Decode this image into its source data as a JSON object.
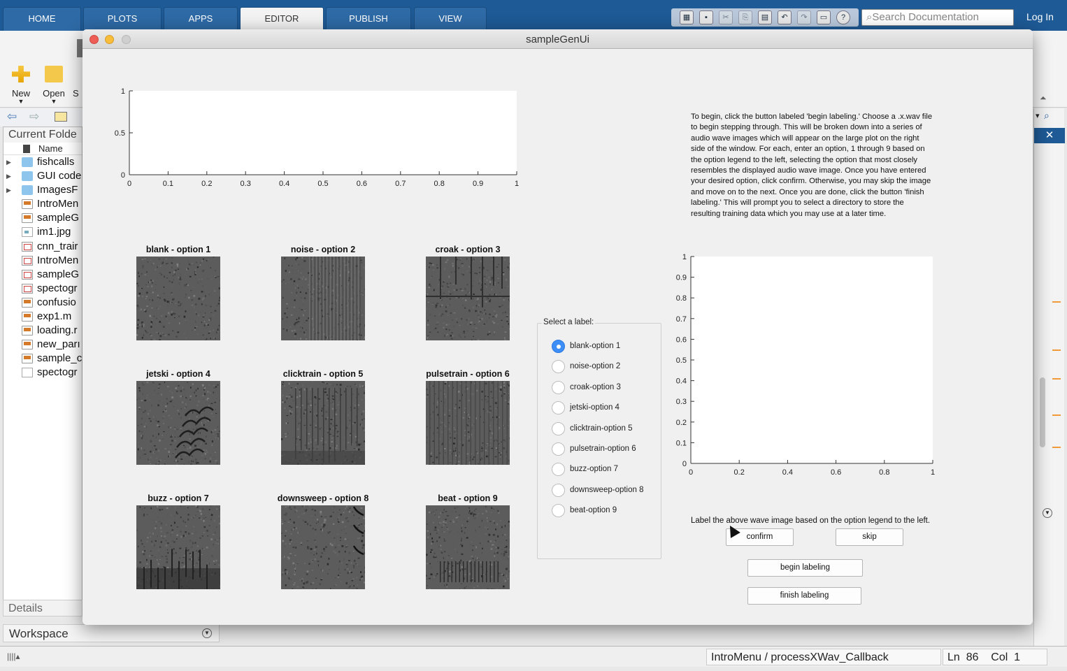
{
  "matlab": {
    "tabs": [
      {
        "label": "HOME",
        "active": false
      },
      {
        "label": "PLOTS",
        "active": false
      },
      {
        "label": "APPS",
        "active": false
      },
      {
        "label": "EDITOR",
        "active": true
      },
      {
        "label": "PUBLISH",
        "active": false
      },
      {
        "label": "VIEW",
        "active": false
      }
    ],
    "search_placeholder": "Search Documentation",
    "login_label": "Log In",
    "toolstrip": {
      "new_label": "New",
      "open_label": "Open",
      "save_partial": "S"
    },
    "current_folder": {
      "title": "Current Folde",
      "name_header": "Name",
      "items": [
        {
          "label": "fishcalls",
          "type": "folder",
          "expandable": true
        },
        {
          "label": "GUI code",
          "type": "folder",
          "expandable": true
        },
        {
          "label": "ImagesF",
          "type": "folder",
          "expandable": true
        },
        {
          "label": "IntroMen",
          "type": "mfile"
        },
        {
          "label": "sampleG",
          "type": "mfile"
        },
        {
          "label": "im1.jpg",
          "type": "img"
        },
        {
          "label": "cnn_trair",
          "type": "fig"
        },
        {
          "label": "IntroMen",
          "type": "fig"
        },
        {
          "label": "sampleG",
          "type": "fig"
        },
        {
          "label": "spectogr",
          "type": "fig"
        },
        {
          "label": "confusio",
          "type": "mfile"
        },
        {
          "label": "exp1.m",
          "type": "mfile"
        },
        {
          "label": "loading.r",
          "type": "mfile"
        },
        {
          "label": "new_parı",
          "type": "mfile"
        },
        {
          "label": "sample_c",
          "type": "mfile"
        },
        {
          "label": "spectogr",
          "type": "blank"
        }
      ]
    },
    "details_label": "Details",
    "workspace_label": "Workspace",
    "status": {
      "file": "IntroMenu / processXWav_Callback",
      "ln_label": "Ln",
      "ln": "86",
      "col_label": "Col",
      "col": "1"
    }
  },
  "window": {
    "title": "sampleGenUi",
    "top_axes": {
      "xlim": [
        0,
        1
      ],
      "ylim": [
        0,
        1
      ],
      "xticks": [
        "0",
        "0.1",
        "0.2",
        "0.3",
        "0.4",
        "0.5",
        "0.6",
        "0.7",
        "0.8",
        "0.9",
        "1"
      ],
      "yticks": [
        "0",
        "0.5",
        "1"
      ]
    },
    "samples": [
      {
        "title": "blank - option 1",
        "pattern": "blank"
      },
      {
        "title": "noise - option 2",
        "pattern": "noise"
      },
      {
        "title": "croak - option 3",
        "pattern": "croak"
      },
      {
        "title": "jetski - option 4",
        "pattern": "jetski"
      },
      {
        "title": "clicktrain - option 5",
        "pattern": "clicktrain"
      },
      {
        "title": "pulsetrain - option 6",
        "pattern": "pulsetrain"
      },
      {
        "title": "buzz - option 7",
        "pattern": "buzz"
      },
      {
        "title": "downsweep - option 8",
        "pattern": "downsweep"
      },
      {
        "title": "beat - option 9",
        "pattern": "beat"
      }
    ],
    "label_group": {
      "title": "Select a label:",
      "options": [
        {
          "label": "blank-option 1",
          "selected": true
        },
        {
          "label": "noise-option 2",
          "selected": false
        },
        {
          "label": "croak-option 3",
          "selected": false
        },
        {
          "label": "jetski-option 4",
          "selected": false
        },
        {
          "label": "clicktrain-option 5",
          "selected": false
        },
        {
          "label": "pulsetrain-option 6",
          "selected": false
        },
        {
          "label": "buzz-option 7",
          "selected": false
        },
        {
          "label": "downsweep-option 8",
          "selected": false
        },
        {
          "label": "beat-option 9",
          "selected": false
        }
      ]
    },
    "instructions": "To begin, click the button labeled 'begin labeling.' Choose a .x.wav file to begin stepping through. This will be broken down into a series of audio wave images which will appear on the large plot on the right side of the window. For each, enter an option, 1 through 9 based on the option legend to the left, selecting the option that most closely resembles the displayed audio wave image. Once you have entered your desired option, click confirm. Otherwise, you may skip the image and move on to the next. Once you are done, click the button 'finish labeling.' This will prompt you to select a directory to store the resulting training data which you may use at a later time.",
    "right_axes": {
      "xlim": [
        0,
        1
      ],
      "ylim": [
        0,
        1
      ],
      "xticks": [
        "0",
        "0.2",
        "0.4",
        "0.6",
        "0.8",
        "1"
      ],
      "yticks": [
        "0",
        "0.1",
        "0.2",
        "0.3",
        "0.4",
        "0.5",
        "0.6",
        "0.7",
        "0.8",
        "0.9",
        "1"
      ]
    },
    "hint": "Label the above wave image based on the option legend to the left.",
    "buttons": {
      "confirm": "confirm",
      "skip": "skip",
      "begin": "begin labeling",
      "finish": "finish labeling"
    }
  },
  "colors": {
    "matlab_blue": "#1e5a96",
    "radio_selected": "#3d8ef7",
    "close": "#ee5e56",
    "minimize": "#f7bd3b"
  }
}
